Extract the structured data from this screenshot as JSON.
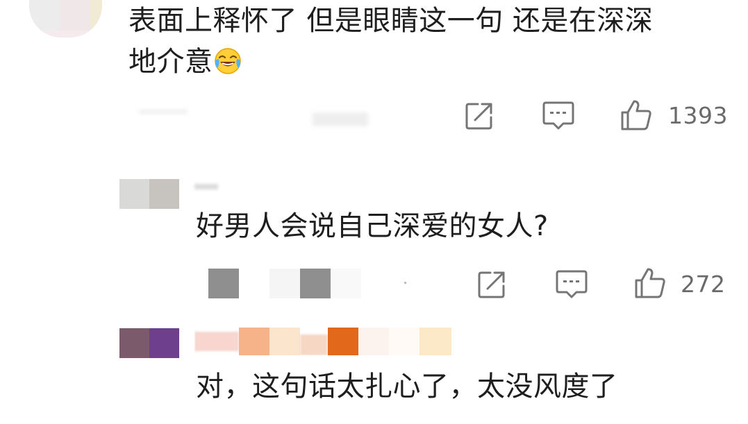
{
  "comments": [
    {
      "text_line1": "表面上释怀了 但是眼睛这一句 还是在深深",
      "text_line2": "地介意",
      "emoji": "laughing-crying-emoji",
      "like_count": "1393",
      "author_label": "",
      "author_colors": [
        "#ececec",
        "#f6e9e3",
        "#f1ebd6"
      ]
    },
    {
      "text": "好男人会说自己深爱的女人?",
      "like_count": "272",
      "author_colors": [
        "#d8d8d8",
        "#c8c6c2"
      ]
    },
    {
      "text": "对，这句话太扎心了，太没风度了",
      "author_colors": [
        "#7a5a6b",
        "#6e3f8c",
        "#f6b38a",
        "#f3d9c0",
        "#e2691b",
        "#fbe9c7"
      ]
    }
  ],
  "icons": {
    "share": "share-icon",
    "comment": "comment-icon",
    "like": "thumb-up-icon"
  },
  "colors": {
    "text": "#1e1e1e",
    "meta": "#6a6a6a",
    "icon": "#757575"
  }
}
